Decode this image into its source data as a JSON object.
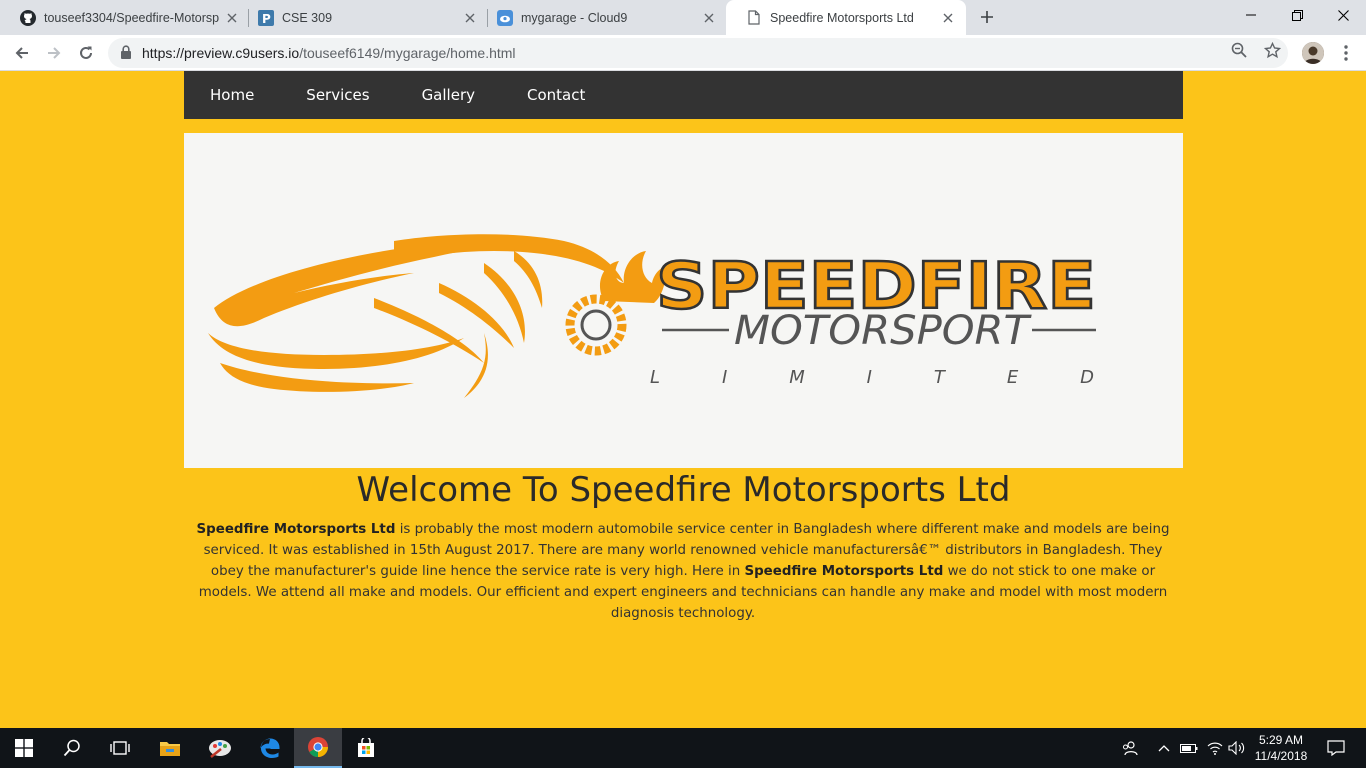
{
  "browser": {
    "tabs": [
      {
        "title": "touseef3304/Speedfire-Motorsp",
        "icon": "github-icon"
      },
      {
        "title": "CSE 309",
        "icon": "piazza-icon"
      },
      {
        "title": "mygarage - Cloud9",
        "icon": "cloud9-icon"
      },
      {
        "title": "Speedfire Motorsports Ltd",
        "icon": "page-icon",
        "active": true
      }
    ],
    "url_host": "https://preview.c9users.io",
    "url_path": "/touseef6149/mygarage/home.html"
  },
  "site": {
    "nav": [
      "Home",
      "Services",
      "Gallery",
      "Contact"
    ],
    "logo": {
      "brand": "SPEEDFIRE",
      "sub": "MOTORSPORT",
      "tagline": "L  I  M  I  T  E  D"
    },
    "heading": "Welcome To Speedfire Motorsports Ltd",
    "intro": {
      "brand_bold": "Speedfire Motorsports Ltd",
      "part1": " is probably the most modern automobile service center in Bangladesh where different make and models are being serviced. It was established in 15th August 2017. There are many world renowned vehicle manufacturersâ€™ distributors in Bangladesh. They obey the manufacturer's guide line hence the service rate is very high. Here in ",
      "brand_bold_2": "Speedfire Motorsports Ltd",
      "part2": " we do not stick to one make or models. We attend all make and models. Our efficient and expert engineers and technicians can handle any make and model with most modern diagnosis technology."
    },
    "colors": {
      "background": "#fcc419",
      "nav": "#333333",
      "logo_orange": "#f39c12"
    }
  },
  "taskbar": {
    "time": "5:29 AM",
    "date": "11/4/2018"
  }
}
